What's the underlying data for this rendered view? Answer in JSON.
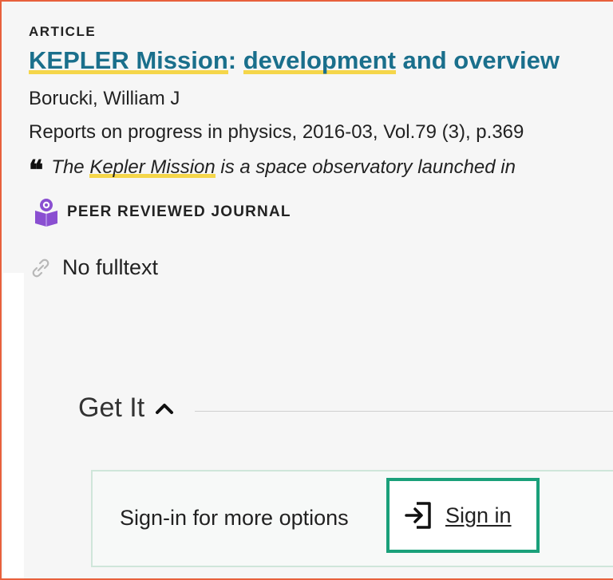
{
  "result": {
    "type_label": "ARTICLE",
    "title_part1": "KEPLER Mission",
    "title_sep": ": ",
    "title_part2": "development",
    "title_part3": " and overview",
    "author": "Borucki, William J",
    "source": "Reports on progress in physics, 2016-03, Vol.79 (3), p.369",
    "snippet_pre": "The ",
    "snippet_highlight": "Kepler Mission",
    "snippet_post": " is a space observatory launched in",
    "peer_reviewed_label": "PEER REVIEWED JOURNAL",
    "fulltext_label": "No fulltext"
  },
  "get_it": {
    "heading": "Get It",
    "prompt": "Sign-in for more options",
    "signin_label": "Sign in"
  },
  "icons": {
    "quote": "quote-icon",
    "peer_reviewed": "peer-reviewed-icon",
    "link": "link-icon",
    "chevron": "chevron-up-icon",
    "signin": "sign-in-icon"
  },
  "colors": {
    "title": "#1a6f8c",
    "highlight": "#f5d64a",
    "frame_border": "#e8603c",
    "signin_border": "#1aa07a",
    "peer_icon": "#8a4fd1"
  }
}
